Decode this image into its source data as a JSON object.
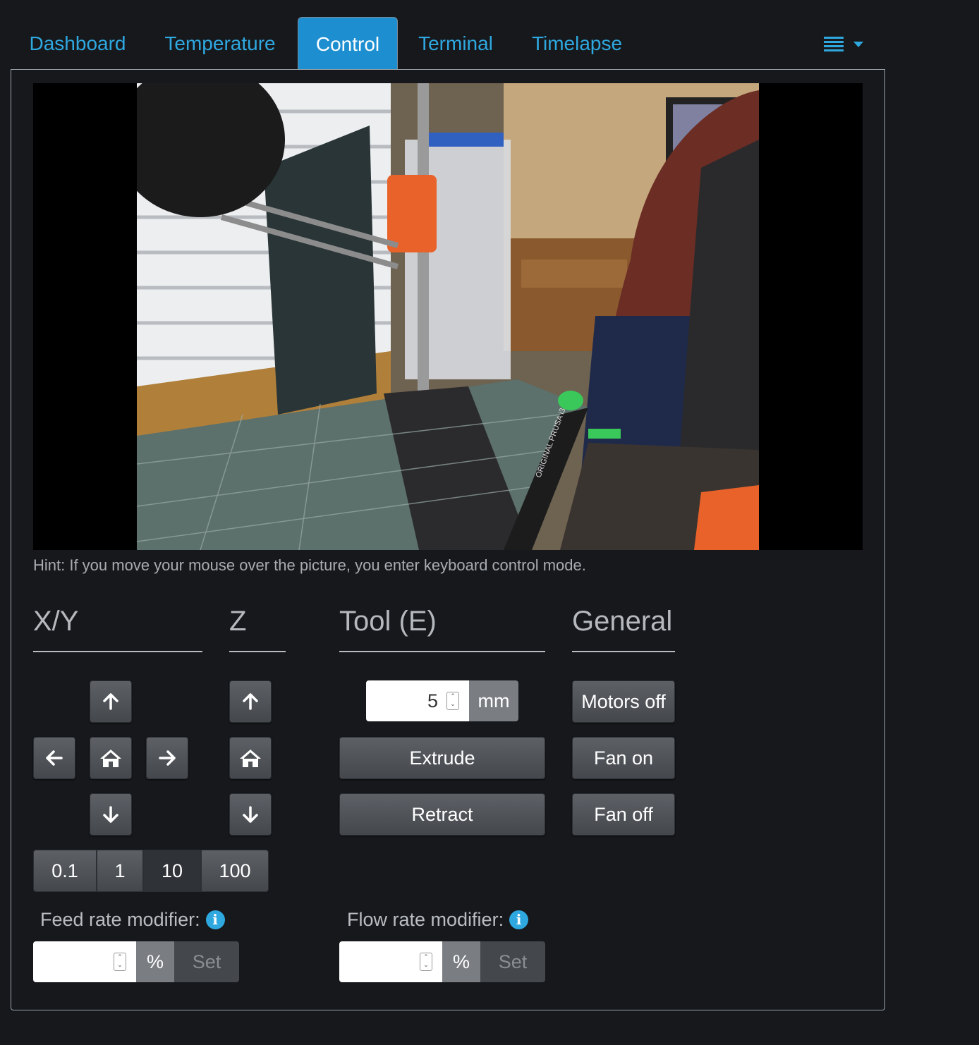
{
  "tabs": [
    {
      "label": "Dashboard"
    },
    {
      "label": "Temperature"
    },
    {
      "label": "Control"
    },
    {
      "label": "Terminal"
    },
    {
      "label": "Timelapse"
    }
  ],
  "active_tab": "Control",
  "webcam": {
    "bed_text": "ORIGINAL PRUSA i3 MK3"
  },
  "hint": "Hint: If you move your mouse over the picture, you enter keyboard control mode.",
  "sections": {
    "xy": "X/Y",
    "z": "Z",
    "tool": "Tool (E)",
    "general": "General"
  },
  "step_sizes": [
    "0.1",
    "1",
    "10",
    "100"
  ],
  "tool": {
    "amount": "5",
    "unit": "mm",
    "extrude": "Extrude",
    "retract": "Retract"
  },
  "general": {
    "motors_off": "Motors off",
    "fan_on": "Fan on",
    "fan_off": "Fan off"
  },
  "feed_rate": {
    "label": "Feed rate modifier:",
    "value": "",
    "unit": "%",
    "set": "Set"
  },
  "flow_rate": {
    "label": "Flow rate modifier:",
    "value": "",
    "unit": "%",
    "set": "Set"
  },
  "colors": {
    "accent": "#2fa8e0",
    "background": "#16181c",
    "active_tab": "#1d8fd0"
  }
}
